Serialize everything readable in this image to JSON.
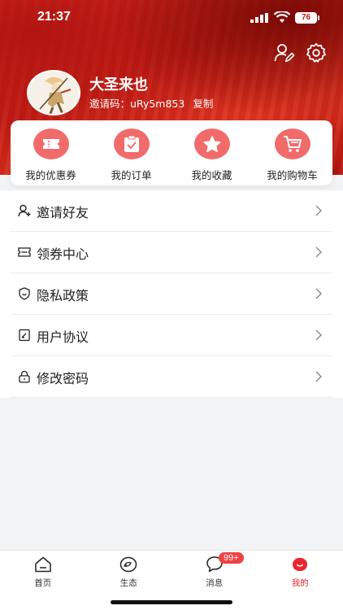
{
  "status_bar": {
    "time": "21:37",
    "battery": "76"
  },
  "profile": {
    "username": "大圣来也",
    "invite_label": "邀请码：",
    "invite_code": "uRy5m853",
    "copy_label": "复制"
  },
  "quick_actions": [
    {
      "label": "我的优惠券",
      "icon": "coupon-icon"
    },
    {
      "label": "我的订单",
      "icon": "order-clipboard-icon"
    },
    {
      "label": "我的收藏",
      "icon": "star-icon"
    },
    {
      "label": "我的购物车",
      "icon": "cart-icon"
    }
  ],
  "menu": [
    {
      "label": "邀请好友",
      "icon": "add-user-icon"
    },
    {
      "label": "领券中心",
      "icon": "ticket-icon"
    },
    {
      "label": "隐私政策",
      "icon": "shield-icon"
    },
    {
      "label": "用户协议",
      "icon": "document-icon"
    },
    {
      "label": "修改密码",
      "icon": "lock-icon"
    }
  ],
  "tabs": [
    {
      "label": "首页",
      "icon": "home-icon"
    },
    {
      "label": "生态",
      "icon": "eco-icon"
    },
    {
      "label": "消息",
      "icon": "message-icon",
      "badge": "99+"
    },
    {
      "label": "我的",
      "icon": "profile-icon",
      "active": true
    }
  ],
  "colors": {
    "accent": "#e8262d",
    "hero": "#c41d14",
    "icon_bg": "#f26b6b"
  }
}
